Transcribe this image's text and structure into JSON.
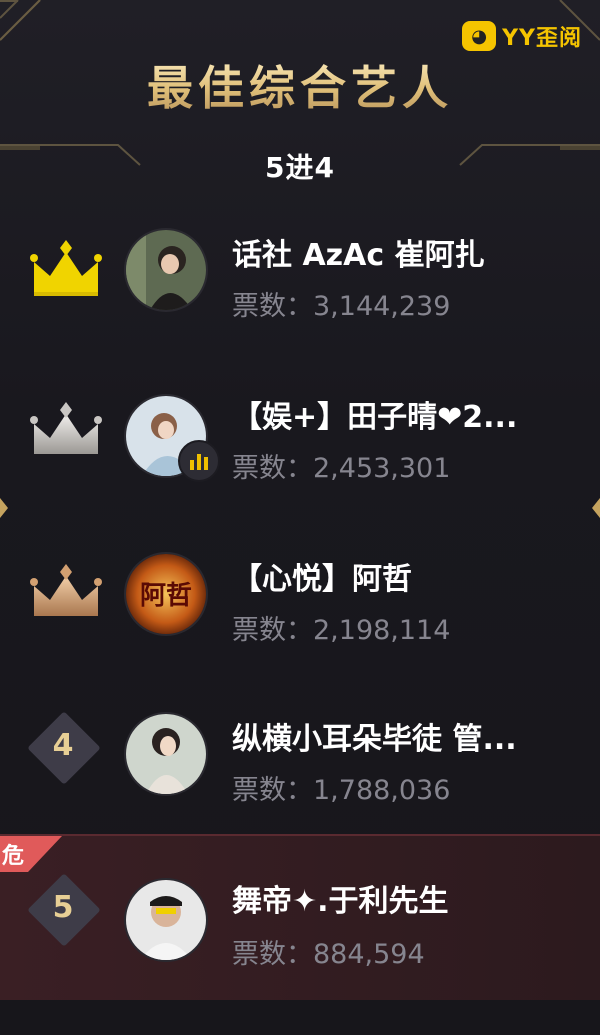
{
  "header": {
    "title": "最佳综合艺人",
    "round": "5进4",
    "brand": "YY歪阅"
  },
  "colors": {
    "gold": "#e9d29a",
    "crown_gold": "#f0d400",
    "crown_silver": "#c9c6c3",
    "crown_bronze": "#d2a071",
    "danger": "#e05a5a"
  },
  "rows": [
    {
      "rank": "1",
      "crown": "gold-crown-icon",
      "name": "话社 AzAc 崔阿扎",
      "votes_label": "票数：",
      "votes": "3,144,239"
    },
    {
      "rank": "2",
      "crown": "silver-crown-icon",
      "name": "【娱+】田子晴❤2...",
      "votes_label": "票数：",
      "votes": "2,453,301",
      "live": true
    },
    {
      "rank": "3",
      "crown": "bronze-crown-icon",
      "name": "【心悦】阿哲",
      "votes_label": "票数：",
      "votes": "2,198,114"
    },
    {
      "rank": "4",
      "name": "纵横小耳朵毕徒 管...",
      "votes_label": "票数：",
      "votes": "1,788,036"
    },
    {
      "rank": "5",
      "name": "舞帝✦.于利先生",
      "votes_label": "票数：",
      "votes": "884,594",
      "danger_label": "危"
    }
  ]
}
